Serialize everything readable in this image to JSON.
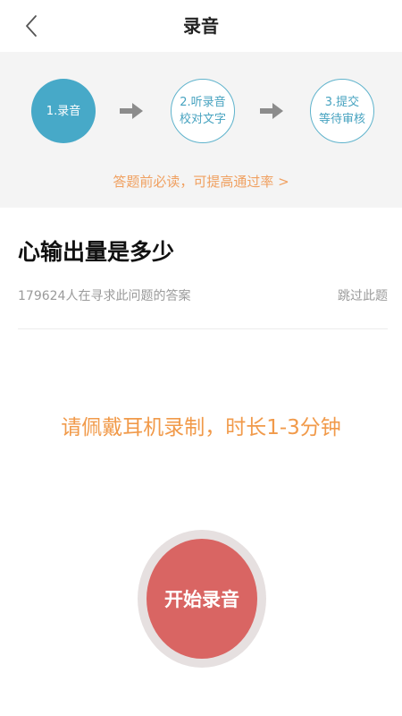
{
  "header": {
    "title": "录音",
    "back_icon": "chevron-left-icon"
  },
  "steps": [
    {
      "label": "1.录音",
      "state": "active"
    },
    {
      "label": "2.听录音\n校对文字",
      "state": "inactive"
    },
    {
      "label": "3.提交\n等待审核",
      "state": "inactive"
    }
  ],
  "steps_tip": "答题前必读，可提高通过率 >",
  "question": {
    "title": "心输出量是多少",
    "seek_count": "179624人在寻求此问题的答案",
    "skip_label": "跳过此题"
  },
  "instruction": "请佩戴耳机录制，时长1-3分钟",
  "record": {
    "button_label": "开始录音"
  },
  "colors": {
    "accent_blue": "#47a9c8",
    "accent_orange": "#f19a4a",
    "record_red": "#d96563",
    "panel_bg": "#f4f4f4"
  }
}
